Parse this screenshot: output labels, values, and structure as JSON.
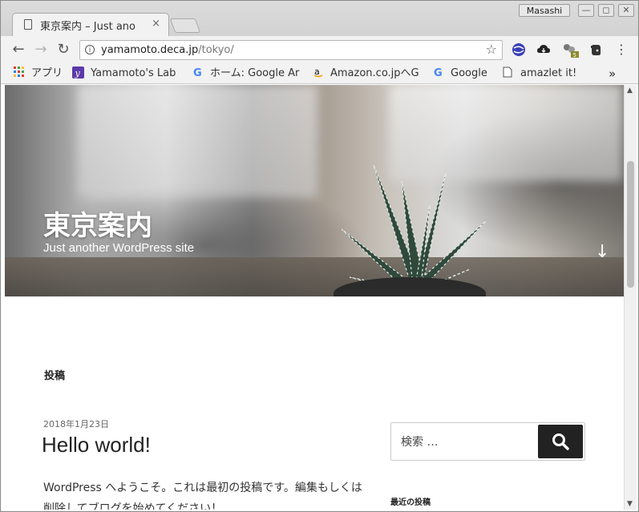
{
  "window": {
    "user_name": "Masashi",
    "tab_title": "東京案内 – Just ano",
    "tab_close": "×"
  },
  "toolbar": {
    "url_host": "yamamoto.deca.jp",
    "url_path": "/tokyo/",
    "info_icon": "i",
    "star_icon": "☆"
  },
  "bookmarks": {
    "items": [
      {
        "label": "アプリ",
        "icon": "apps-grid-icon"
      },
      {
        "label": "Yamamoto's Lab",
        "icon": "yahoo-icon"
      },
      {
        "label": "ホーム: Google Ar",
        "icon": "google-icon"
      },
      {
        "label": "Amazon.co.jpへG",
        "icon": "amazon-icon"
      },
      {
        "label": "Google",
        "icon": "google-icon"
      },
      {
        "label": "amazlet it!",
        "icon": "page-icon"
      }
    ],
    "overflow": "»"
  },
  "hero": {
    "site_title": "東京案内",
    "tagline": "Just another WordPress site",
    "scroll_arrow": "↓"
  },
  "content": {
    "section_title": "投稿",
    "post_date": "2018年1月23日",
    "post_title": "Hello world!",
    "post_excerpt": "WordPress へようこそ。これは最初の投稿です。編集もしくは削除してブログを始めてください！",
    "search_placeholder": "検索 …",
    "recent_posts_title": "最近の投稿"
  },
  "colors": {
    "accent_dark": "#222222",
    "chrome_bg": "#f2f2f2"
  }
}
